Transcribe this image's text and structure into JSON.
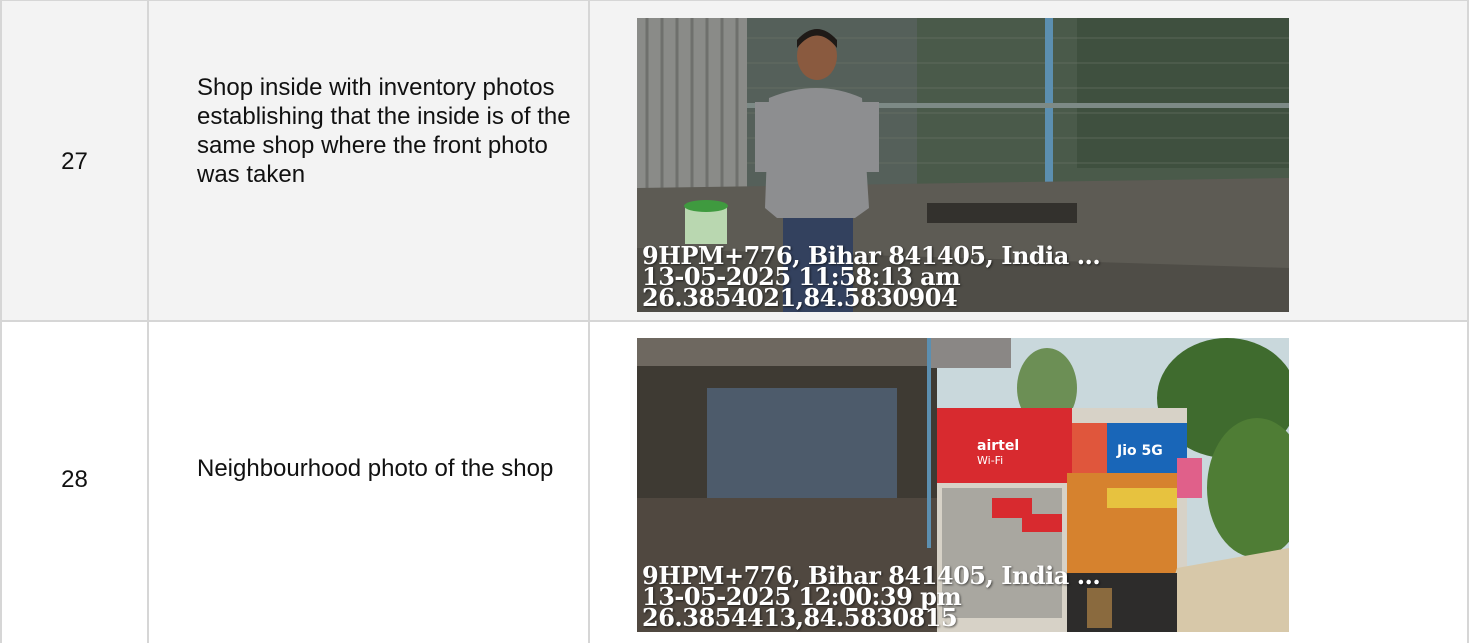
{
  "rows": [
    {
      "number": "27",
      "description": "Shop inside with inventory photos establishing that the inside is of the same shop where the front photo was taken",
      "photo": {
        "address": "9HPM+776, Bihar 841405, India ...",
        "timestamp": "13-05-2025 11:58:13 am",
        "coordinates": "26.3854021,84.5830904"
      }
    },
    {
      "number": "28",
      "description": "Neighbourhood photo of the shop",
      "photo": {
        "address": "9HPM+776, Bihar 841405, India ...",
        "timestamp": "13-05-2025 12:00:39 pm",
        "coordinates": "26.3854413,84.5830815"
      }
    }
  ],
  "colors": {
    "row_alt_bg": "#f3f3f3",
    "border": "#d6d6d6"
  }
}
